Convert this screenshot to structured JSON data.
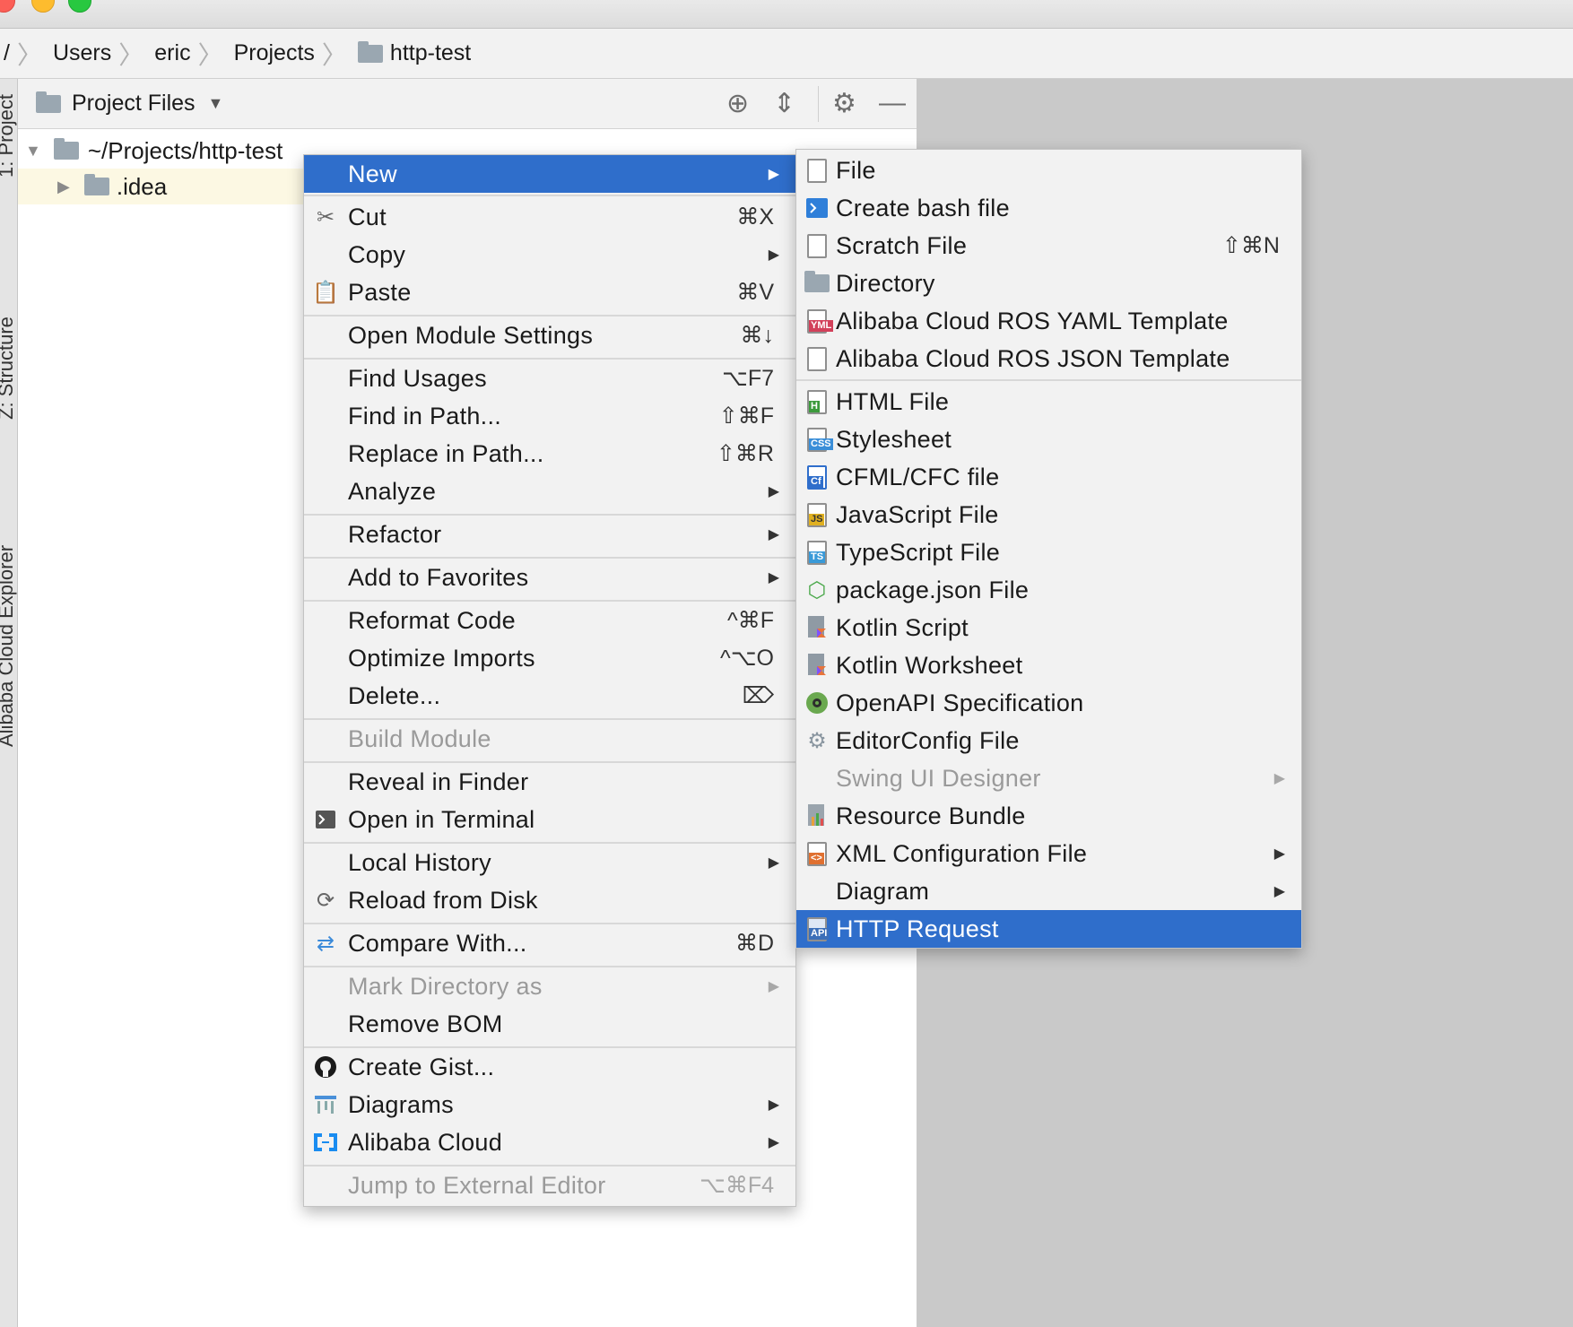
{
  "breadcrumbs": [
    "/",
    "Users",
    "eric",
    "Projects",
    "http-test"
  ],
  "side_tabs": [
    "1: Project",
    "Z: Structure",
    "Alibaba Cloud Explorer"
  ],
  "project_panel": {
    "title": "Project Files",
    "tree": [
      {
        "label": "~/Projects/http-test",
        "expanded": true
      },
      {
        "label": ".idea",
        "expanded": false
      }
    ]
  },
  "context_menu": {
    "items": [
      {
        "label": "New",
        "shortcut": "",
        "submenu": true,
        "selected": true
      },
      {
        "label": "Cut",
        "shortcut": "⌘X",
        "icon": "scissors-icon"
      },
      {
        "label": "Copy",
        "shortcut": "",
        "submenu": true
      },
      {
        "label": "Paste",
        "shortcut": "⌘V",
        "icon": "clipboard-icon"
      },
      {
        "label": "Open Module Settings",
        "shortcut": "⌘↓"
      },
      {
        "label": "Find Usages",
        "shortcut": "⌥F7"
      },
      {
        "label": "Find in Path...",
        "shortcut": "⇧⌘F"
      },
      {
        "label": "Replace in Path...",
        "shortcut": "⇧⌘R"
      },
      {
        "label": "Analyze",
        "shortcut": "",
        "submenu": true
      },
      {
        "label": "Refactor",
        "shortcut": "",
        "submenu": true
      },
      {
        "label": "Add to Favorites",
        "shortcut": "",
        "submenu": true
      },
      {
        "label": "Reformat Code",
        "shortcut": "^⌘F"
      },
      {
        "label": "Optimize Imports",
        "shortcut": "^⌥O"
      },
      {
        "label": "Delete...",
        "shortcut": "⌦"
      },
      {
        "label": "Build Module",
        "shortcut": "",
        "disabled": true
      },
      {
        "label": "Reveal in Finder",
        "shortcut": ""
      },
      {
        "label": "Open in Terminal",
        "shortcut": "",
        "icon": "terminal-icon"
      },
      {
        "label": "Local History",
        "shortcut": "",
        "submenu": true
      },
      {
        "label": "Reload from Disk",
        "shortcut": "",
        "icon": "reload-icon"
      },
      {
        "label": "Compare With...",
        "shortcut": "⌘D",
        "icon": "compare-icon"
      },
      {
        "label": "Mark Directory as",
        "shortcut": "",
        "submenu": true,
        "disabled": true
      },
      {
        "label": "Remove BOM",
        "shortcut": ""
      },
      {
        "label": "Create Gist...",
        "shortcut": "",
        "icon": "github-icon"
      },
      {
        "label": "Diagrams",
        "shortcut": "",
        "submenu": true,
        "icon": "diagram-icon"
      },
      {
        "label": "Alibaba Cloud",
        "shortcut": "",
        "submenu": true,
        "icon": "alibaba-cloud-icon"
      },
      {
        "label": "Jump to External Editor",
        "shortcut": "⌥⌘F4",
        "disabled": true
      }
    ]
  },
  "new_submenu": {
    "items": [
      {
        "label": "File",
        "shortcut": ""
      },
      {
        "label": "Create bash file",
        "shortcut": ""
      },
      {
        "label": "Scratch File",
        "shortcut": "⇧⌘N"
      },
      {
        "label": "Directory",
        "shortcut": ""
      },
      {
        "label": "Alibaba Cloud ROS YAML Template",
        "shortcut": "",
        "tag": "YML"
      },
      {
        "label": "Alibaba Cloud ROS JSON Template",
        "shortcut": ""
      },
      {
        "label": "HTML File",
        "shortcut": "",
        "tag": "H"
      },
      {
        "label": "Stylesheet",
        "shortcut": "",
        "tag": "CSS"
      },
      {
        "label": "CFML/CFC file",
        "shortcut": "",
        "tag": "Cf"
      },
      {
        "label": "JavaScript File",
        "shortcut": "",
        "tag": "JS"
      },
      {
        "label": "TypeScript File",
        "shortcut": "",
        "tag": "TS"
      },
      {
        "label": "package.json File",
        "shortcut": ""
      },
      {
        "label": "Kotlin Script",
        "shortcut": ""
      },
      {
        "label": "Kotlin Worksheet",
        "shortcut": ""
      },
      {
        "label": "OpenAPI Specification",
        "shortcut": ""
      },
      {
        "label": "EditorConfig File",
        "shortcut": ""
      },
      {
        "label": "Swing UI Designer",
        "shortcut": "",
        "submenu": true,
        "disabled": true
      },
      {
        "label": "Resource Bundle",
        "shortcut": ""
      },
      {
        "label": "XML Configuration File",
        "shortcut": "",
        "submenu": true,
        "tag": "<>"
      },
      {
        "label": "Diagram",
        "shortcut": "",
        "submenu": true
      },
      {
        "label": "HTTP Request",
        "shortcut": "",
        "selected": true,
        "tag": "API"
      }
    ]
  },
  "colors": {
    "selection": "#2f6ecb",
    "menu_bg": "#f2f2f2",
    "tree_highlight": "#fcf8e3"
  }
}
